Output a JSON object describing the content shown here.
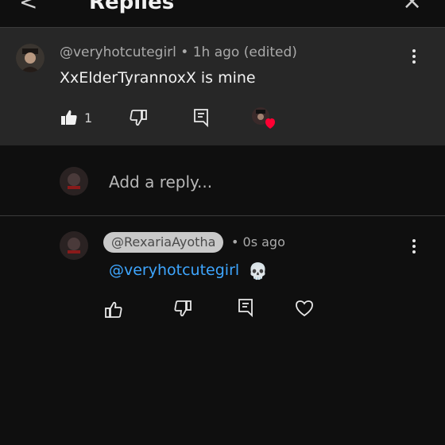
{
  "header": {
    "title": "Replies",
    "back_glyph": "<",
    "close_glyph": "×"
  },
  "parent_comment": {
    "author_line": "@veryhotcutegirl • 1h ago (edited)",
    "text": "XxElderTyrannoxX is mine",
    "like_count": "1",
    "icons": [
      "like-filled-icon",
      "dislike-icon",
      "reply-icon",
      "creator-heart-avatar"
    ]
  },
  "reply_input": {
    "placeholder": "Add a reply..."
  },
  "reply": {
    "author": "@RexariaAyotha",
    "time": "• 0s ago",
    "mention": "@veryhotcutegirl",
    "emoji": "💀",
    "icons": [
      "like-icon",
      "dislike-icon",
      "reply-icon",
      "heart-icon"
    ]
  },
  "colors": {
    "background": "#0f0f0f",
    "highlight": "#272727",
    "link": "#3ea6ff",
    "heart": "#ff0033"
  }
}
